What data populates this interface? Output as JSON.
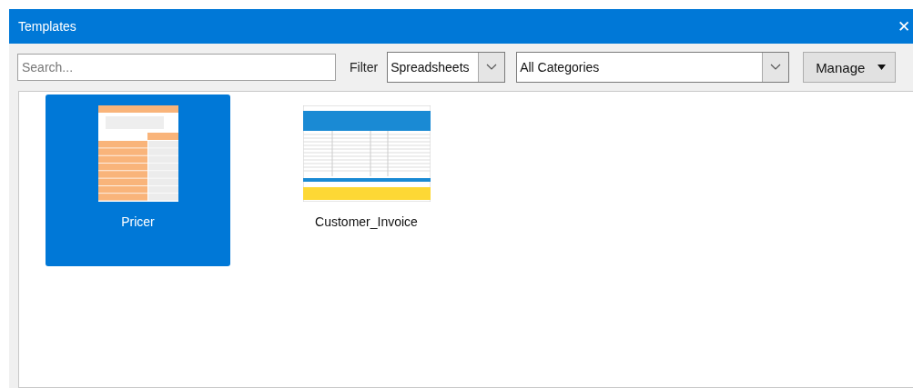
{
  "window": {
    "title": "Templates",
    "close": "✕"
  },
  "toolbar": {
    "search": {
      "placeholder": "Search..."
    },
    "filter_label": "Filter",
    "filter": {
      "value": "Spreadsheets"
    },
    "category": {
      "value": "All Categories"
    },
    "manage": {
      "label": "Manage"
    }
  },
  "templates": [
    {
      "name": "Pricer",
      "kind": "calculator",
      "selected": true
    },
    {
      "name": "Customer_Invoice",
      "kind": "invoice",
      "selected": false
    }
  ]
}
